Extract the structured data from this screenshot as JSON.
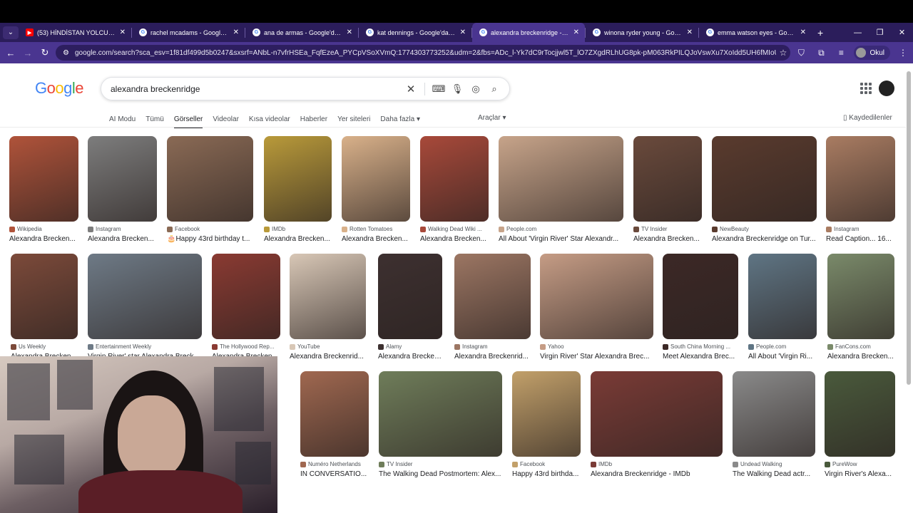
{
  "browser": {
    "tabs": [
      {
        "title": "(53) HİNDİSTAN YOLCULUĞU V",
        "type": "yt"
      },
      {
        "title": "rachel mcadams - Google'da Ara",
        "type": "g"
      },
      {
        "title": "ana de armas - Google'da Ara",
        "type": "g"
      },
      {
        "title": "kat dennings - Google'da Ara",
        "type": "g"
      },
      {
        "title": "alexandra breckenridge - Goog",
        "type": "g",
        "active": true
      },
      {
        "title": "winona ryder young - Google'da",
        "type": "g"
      },
      {
        "title": "emma watson eyes - Google'da A",
        "type": "g"
      }
    ],
    "url": "google.com/search?sca_esv=1f81df499d5b0247&sxsrf=ANbL-n7vfrHSEa_FqfEzeA_PYCpVSoXVmQ:1774303773252&udm=2&fbs=ADc_l-Yk7dC9rTocjjwl5T_lO7ZXgdRLhUG8pk-pM063RkPILQJoVswXu7XoIdd5UH6fMIoUDtgozPEINwZYSjs_...",
    "profile_label": "Okul"
  },
  "google": {
    "logo": "Google",
    "query": "alexandra breckenridge",
    "filters": [
      "AI Modu",
      "Tümü",
      "Görseller",
      "Videolar",
      "Kısa videolar",
      "Haberler",
      "Yer siteleri",
      "Daha fazla"
    ],
    "selected_filter": "Görseller",
    "tools": "Araçlar",
    "saved": "Kaydedilenler"
  },
  "results": [
    {
      "source": "Wikipedia",
      "caption": "Alexandra Brecken...",
      "color": "#b0533a"
    },
    {
      "source": "Instagram",
      "caption": "Alexandra Brecken...",
      "color": "#7d7d7d"
    },
    {
      "source": "Facebook",
      "caption": "🎂Happy 43rd birthday t...",
      "color": "#8a6a55"
    },
    {
      "source": "IMDb",
      "caption": "Alexandra Brecken...",
      "color": "#b99a3a"
    },
    {
      "source": "Rotten Tomatoes",
      "caption": "Alexandra Brecken...",
      "color": "#d9b18a"
    },
    {
      "source": "Walking Dead Wiki ...",
      "caption": "Alexandra Brecken...",
      "color": "#a8493a"
    },
    {
      "source": "People.com",
      "caption": "All About 'Virgin River' Star Alexandr...",
      "color": "#c7a48a"
    },
    {
      "source": "TV Insider",
      "caption": "Alexandra Brecken...",
      "color": "#6a4a3c"
    },
    {
      "source": "NewBeauty",
      "caption": "Alexandra Breckenridge on Tur...",
      "color": "#5a3b2e"
    },
    {
      "source": "Instagram",
      "caption": "Read Caption... 16...",
      "color": "#a97c62"
    },
    {
      "source": "Us Weekly",
      "caption": "Alexandra Brecken...",
      "color": "#7c4a3a"
    },
    {
      "source": "Entertainment Weekly",
      "caption": "Virgin River' star Alexandra Breck...",
      "color": "#6e7a86"
    },
    {
      "source": "The Hollywood Rep...",
      "caption": "Alexandra Brecken...",
      "color": "#8a3a32"
    },
    {
      "source": "YouTube",
      "caption": "Alexandra Breckenrid...",
      "color": "#d8c7b6"
    },
    {
      "source": "Alamy",
      "caption": "Alexandra Brecken...",
      "color": "#3d3030"
    },
    {
      "source": "Instagram",
      "caption": "Alexandra Breckenrid...",
      "color": "#9c7663"
    },
    {
      "source": "Yahoo",
      "caption": "Virgin River' Star Alexandra Brec...",
      "color": "#c59c85"
    },
    {
      "source": "South China Morning ...",
      "caption": "Meet Alexandra Brec...",
      "color": "#3c2826"
    },
    {
      "source": "People.com",
      "caption": "All About 'Virgin Ri...",
      "color": "#5f7584"
    },
    {
      "source": "FanCons.com",
      "caption": "Alexandra Brecken...",
      "color": "#7a8a6a"
    },
    {
      "source": "Numéro Netherlands",
      "caption": "IN CONVERSATIO...",
      "color": "#a06850"
    },
    {
      "source": "TV Insider",
      "caption": "The Walking Dead Postmortem: Alex...",
      "color": "#6f7d5a"
    },
    {
      "source": "Facebook",
      "caption": "Happy 43rd birthda...",
      "color": "#c2a06a"
    },
    {
      "source": "IMDb",
      "caption": "Alexandra Breckenridge - IMDb",
      "color": "#7a3b36"
    },
    {
      "source": "Undead Walking",
      "caption": "The Walking Dead actr...",
      "color": "#8a8a8a"
    },
    {
      "source": "PureWow",
      "caption": "Virgin River's Alexa...",
      "color": "#4a5a3c"
    }
  ]
}
